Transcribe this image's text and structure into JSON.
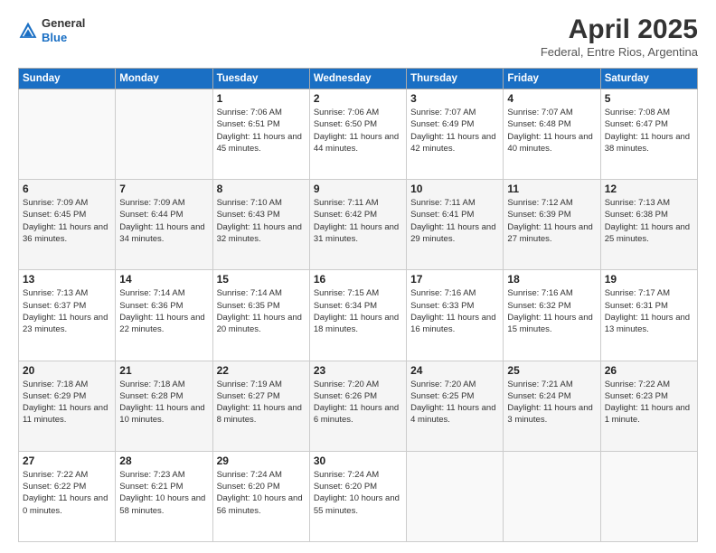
{
  "header": {
    "logo_general": "General",
    "logo_blue": "Blue",
    "month_year": "April 2025",
    "location": "Federal, Entre Rios, Argentina"
  },
  "weekdays": [
    "Sunday",
    "Monday",
    "Tuesday",
    "Wednesday",
    "Thursday",
    "Friday",
    "Saturday"
  ],
  "weeks": [
    [
      {
        "day": "",
        "info": ""
      },
      {
        "day": "",
        "info": ""
      },
      {
        "day": "1",
        "info": "Sunrise: 7:06 AM\nSunset: 6:51 PM\nDaylight: 11 hours and 45 minutes."
      },
      {
        "day": "2",
        "info": "Sunrise: 7:06 AM\nSunset: 6:50 PM\nDaylight: 11 hours and 44 minutes."
      },
      {
        "day": "3",
        "info": "Sunrise: 7:07 AM\nSunset: 6:49 PM\nDaylight: 11 hours and 42 minutes."
      },
      {
        "day": "4",
        "info": "Sunrise: 7:07 AM\nSunset: 6:48 PM\nDaylight: 11 hours and 40 minutes."
      },
      {
        "day": "5",
        "info": "Sunrise: 7:08 AM\nSunset: 6:47 PM\nDaylight: 11 hours and 38 minutes."
      }
    ],
    [
      {
        "day": "6",
        "info": "Sunrise: 7:09 AM\nSunset: 6:45 PM\nDaylight: 11 hours and 36 minutes."
      },
      {
        "day": "7",
        "info": "Sunrise: 7:09 AM\nSunset: 6:44 PM\nDaylight: 11 hours and 34 minutes."
      },
      {
        "day": "8",
        "info": "Sunrise: 7:10 AM\nSunset: 6:43 PM\nDaylight: 11 hours and 32 minutes."
      },
      {
        "day": "9",
        "info": "Sunrise: 7:11 AM\nSunset: 6:42 PM\nDaylight: 11 hours and 31 minutes."
      },
      {
        "day": "10",
        "info": "Sunrise: 7:11 AM\nSunset: 6:41 PM\nDaylight: 11 hours and 29 minutes."
      },
      {
        "day": "11",
        "info": "Sunrise: 7:12 AM\nSunset: 6:39 PM\nDaylight: 11 hours and 27 minutes."
      },
      {
        "day": "12",
        "info": "Sunrise: 7:13 AM\nSunset: 6:38 PM\nDaylight: 11 hours and 25 minutes."
      }
    ],
    [
      {
        "day": "13",
        "info": "Sunrise: 7:13 AM\nSunset: 6:37 PM\nDaylight: 11 hours and 23 minutes."
      },
      {
        "day": "14",
        "info": "Sunrise: 7:14 AM\nSunset: 6:36 PM\nDaylight: 11 hours and 22 minutes."
      },
      {
        "day": "15",
        "info": "Sunrise: 7:14 AM\nSunset: 6:35 PM\nDaylight: 11 hours and 20 minutes."
      },
      {
        "day": "16",
        "info": "Sunrise: 7:15 AM\nSunset: 6:34 PM\nDaylight: 11 hours and 18 minutes."
      },
      {
        "day": "17",
        "info": "Sunrise: 7:16 AM\nSunset: 6:33 PM\nDaylight: 11 hours and 16 minutes."
      },
      {
        "day": "18",
        "info": "Sunrise: 7:16 AM\nSunset: 6:32 PM\nDaylight: 11 hours and 15 minutes."
      },
      {
        "day": "19",
        "info": "Sunrise: 7:17 AM\nSunset: 6:31 PM\nDaylight: 11 hours and 13 minutes."
      }
    ],
    [
      {
        "day": "20",
        "info": "Sunrise: 7:18 AM\nSunset: 6:29 PM\nDaylight: 11 hours and 11 minutes."
      },
      {
        "day": "21",
        "info": "Sunrise: 7:18 AM\nSunset: 6:28 PM\nDaylight: 11 hours and 10 minutes."
      },
      {
        "day": "22",
        "info": "Sunrise: 7:19 AM\nSunset: 6:27 PM\nDaylight: 11 hours and 8 minutes."
      },
      {
        "day": "23",
        "info": "Sunrise: 7:20 AM\nSunset: 6:26 PM\nDaylight: 11 hours and 6 minutes."
      },
      {
        "day": "24",
        "info": "Sunrise: 7:20 AM\nSunset: 6:25 PM\nDaylight: 11 hours and 4 minutes."
      },
      {
        "day": "25",
        "info": "Sunrise: 7:21 AM\nSunset: 6:24 PM\nDaylight: 11 hours and 3 minutes."
      },
      {
        "day": "26",
        "info": "Sunrise: 7:22 AM\nSunset: 6:23 PM\nDaylight: 11 hours and 1 minute."
      }
    ],
    [
      {
        "day": "27",
        "info": "Sunrise: 7:22 AM\nSunset: 6:22 PM\nDaylight: 11 hours and 0 minutes."
      },
      {
        "day": "28",
        "info": "Sunrise: 7:23 AM\nSunset: 6:21 PM\nDaylight: 10 hours and 58 minutes."
      },
      {
        "day": "29",
        "info": "Sunrise: 7:24 AM\nSunset: 6:20 PM\nDaylight: 10 hours and 56 minutes."
      },
      {
        "day": "30",
        "info": "Sunrise: 7:24 AM\nSunset: 6:20 PM\nDaylight: 10 hours and 55 minutes."
      },
      {
        "day": "",
        "info": ""
      },
      {
        "day": "",
        "info": ""
      },
      {
        "day": "",
        "info": ""
      }
    ]
  ]
}
